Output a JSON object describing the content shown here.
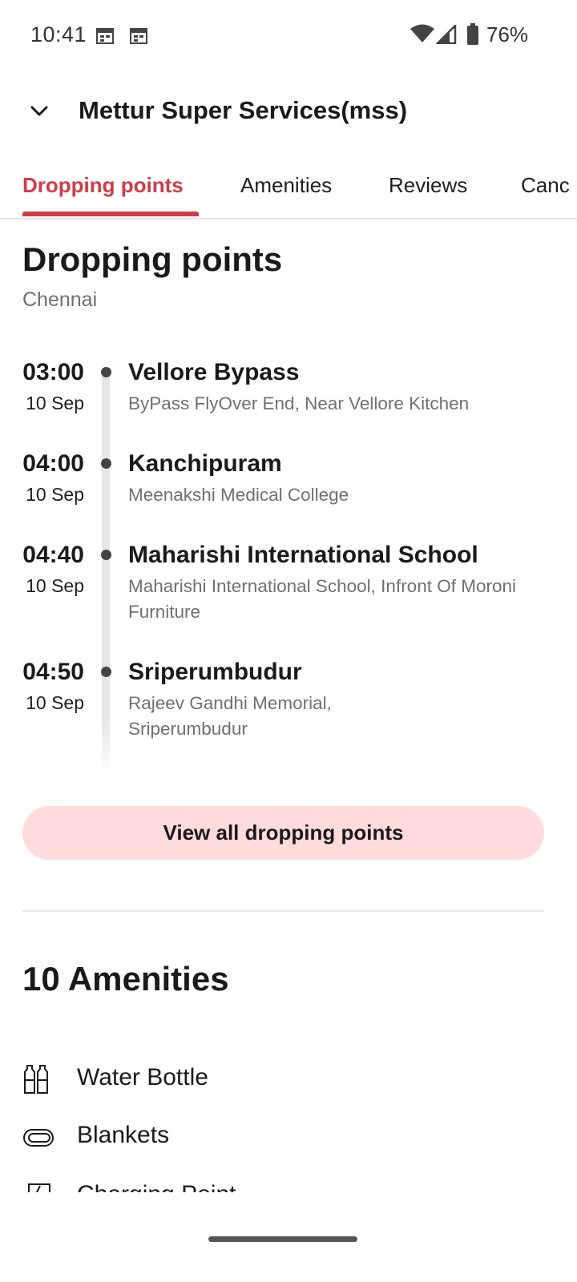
{
  "status_bar": {
    "time": "10:41",
    "battery": "76%",
    "icons": [
      "calendar-notification-icon",
      "calendar-notification-icon",
      "wifi-icon",
      "cellular-signal-icon",
      "battery-icon"
    ]
  },
  "header": {
    "back_icon": "chevron-down-icon",
    "title": "Mettur Super Services(mss)"
  },
  "tabs": [
    {
      "label": "Dropping points",
      "active": true
    },
    {
      "label": "Amenities",
      "active": false
    },
    {
      "label": "Reviews",
      "active": false
    },
    {
      "label": "Canc",
      "active": false
    }
  ],
  "dropping_points": {
    "title": "Dropping points",
    "city": "Chennai",
    "stops": [
      {
        "time": "03:00",
        "date": "10 Sep",
        "name": "Vellore Bypass",
        "address": "ByPass FlyOver End, Near Vellore Kitchen"
      },
      {
        "time": "04:00",
        "date": "10 Sep",
        "name": "Kanchipuram",
        "address": "Meenakshi Medical College"
      },
      {
        "time": "04:40",
        "date": "10 Sep",
        "name": "Maharishi International School",
        "address": "Maharishi International School, Infront Of Moroni Furniture"
      },
      {
        "time": "04:50",
        "date": "10 Sep",
        "name": "Sriperumbudur",
        "address": "Rajeev Gandhi Memorial, Sriperumbudur"
      }
    ],
    "view_all_label": "View all dropping points"
  },
  "amenities": {
    "title": "10 Amenities",
    "items": [
      {
        "label": "Water Bottle",
        "icon": "water-bottle-icon"
      },
      {
        "label": "Blankets",
        "icon": "blanket-icon"
      },
      {
        "label": "Charging Point",
        "icon": "charging-point-icon"
      }
    ]
  },
  "colors": {
    "accent": "#d63a45",
    "button_bg": "#ffdcdc",
    "text_primary": "#1a1a1a",
    "text_secondary": "#707070"
  }
}
